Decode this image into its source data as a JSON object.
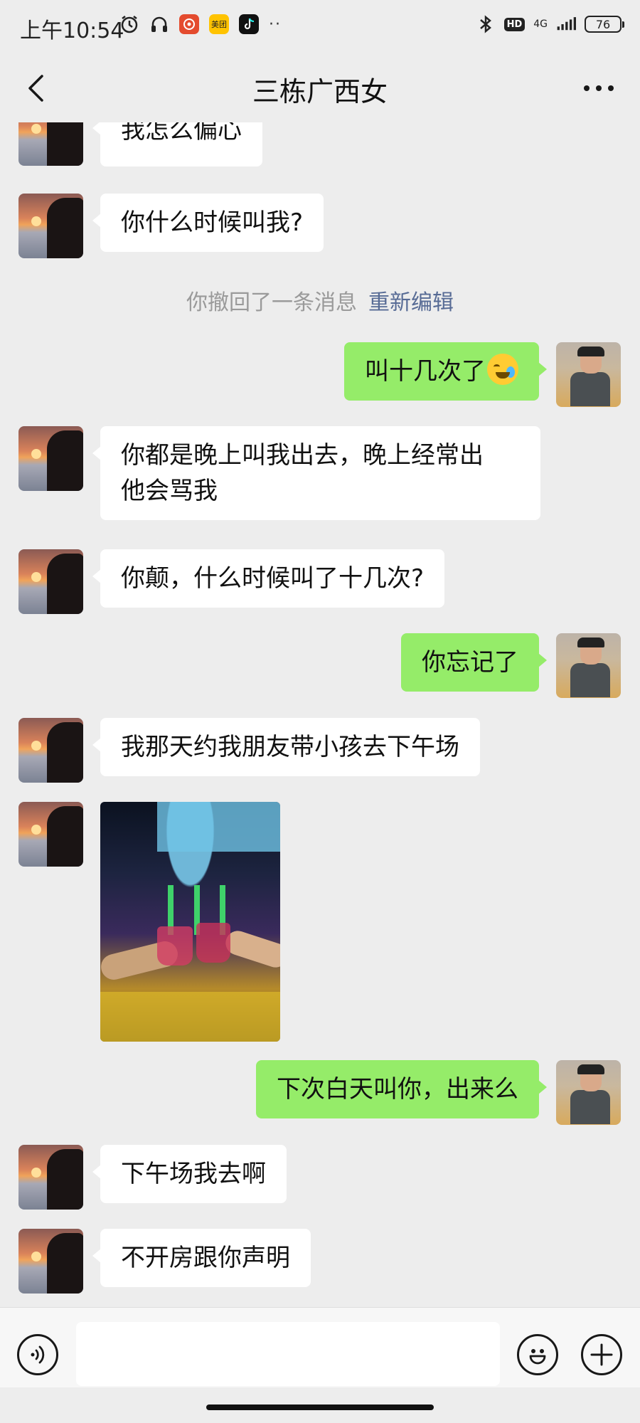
{
  "status_bar": {
    "time": "上午10:54",
    "app_badges": [
      "美团"
    ],
    "network": "4G",
    "battery": "76"
  },
  "header": {
    "title": "三栋广西女"
  },
  "messages": [
    {
      "side": "left",
      "text": "我怎么偏心"
    },
    {
      "side": "left",
      "text": "你什么时候叫我?"
    },
    {
      "type": "system",
      "text": "你撤回了一条消息",
      "action": "重新编辑"
    },
    {
      "side": "right",
      "text": "叫十几次了",
      "emoji": "crying-laughing"
    },
    {
      "side": "left",
      "text": "你都是晚上叫我出去，晚上经常出\n他会骂我"
    },
    {
      "side": "left",
      "text": "你颠，什么时候叫了十几次?"
    },
    {
      "side": "right",
      "text": "你忘记了"
    },
    {
      "side": "left",
      "text": "我那天约我朋友带小孩去下午场"
    },
    {
      "side": "left",
      "type": "image"
    },
    {
      "side": "right",
      "text": "下次白天叫你，出来么"
    },
    {
      "side": "left",
      "text": "下午场我去啊"
    },
    {
      "side": "left",
      "text": "不开房跟你声明"
    }
  ],
  "input_bar": {
    "text_value": "",
    "voice_icon": "voice-icon",
    "emoji_icon": "emoji-icon",
    "plus_icon": "plus-icon"
  },
  "colors": {
    "background": "#ededed",
    "self_bubble": "#95ec69",
    "other_bubble": "#ffffff",
    "link": "#576b95"
  }
}
